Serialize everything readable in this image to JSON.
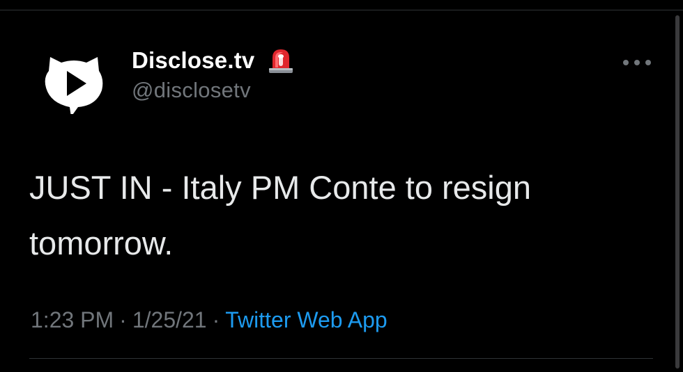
{
  "tweet": {
    "author": {
      "display_name": "Disclose.tv",
      "handle": "@disclosetv",
      "avatar_icon": "play-speech-bubble-icon",
      "badge_icon": "siren-emoji-icon"
    },
    "text": "JUST IN - Italy PM Conte to resign tomorrow.",
    "time": "1:23 PM",
    "date": "1/25/21",
    "separator": "·",
    "source": "Twitter Web App"
  },
  "colors": {
    "background": "#000000",
    "text": "#e7e9ea",
    "secondary": "#71767b",
    "link": "#1d9bf0",
    "divider": "#2f3336"
  }
}
